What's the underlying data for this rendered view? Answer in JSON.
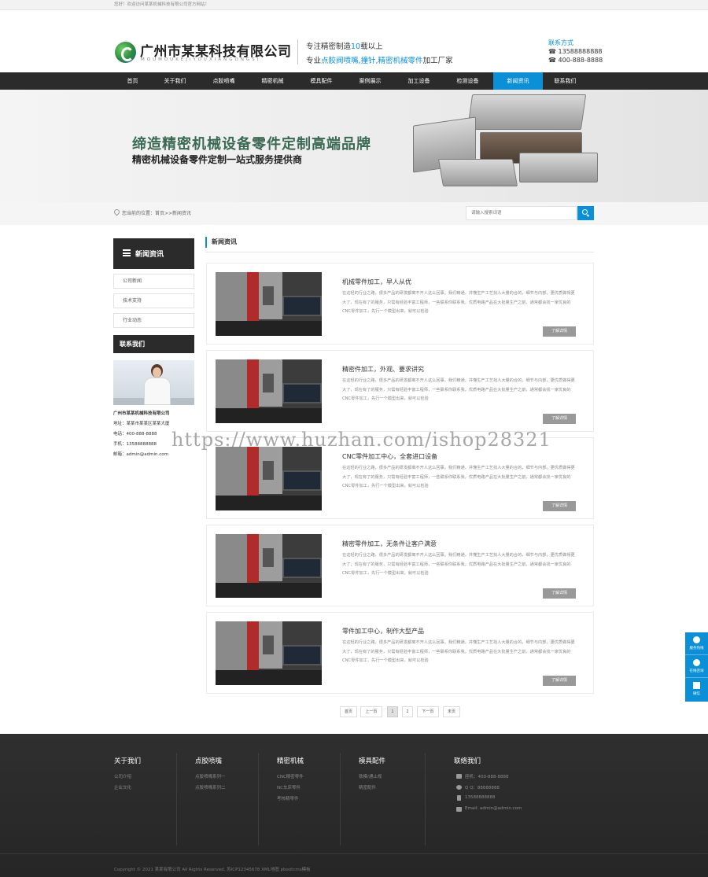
{
  "topbar": {
    "text": "您好！欢迎访问某某机械科技有限公司官方网站！"
  },
  "header": {
    "logo_title": "广州市某某科技有限公司",
    "logo_sub": "MOUMOUKEJIYOUXIANGONGSI",
    "slogan1_prefix": "专注精密制造",
    "slogan1_highlight": "10",
    "slogan1_suffix": "载以上",
    "slogan2_prefix": "专业",
    "slogan2_highlight": "点胶阀喷嘴,撞针,精密机械零件",
    "slogan2_suffix": "加工厂家",
    "contact_title": "联系方式",
    "phone1": "13588888888",
    "phone2": "400-888-8888"
  },
  "nav": {
    "items": [
      {
        "label": "首页"
      },
      {
        "label": "关于我们"
      },
      {
        "label": "点胶喷嘴"
      },
      {
        "label": "精密机械"
      },
      {
        "label": "模具配件"
      },
      {
        "label": "案例展示"
      },
      {
        "label": "加工设备"
      },
      {
        "label": "检测设备"
      },
      {
        "label": "新闻资讯",
        "active": true
      },
      {
        "label": "联系我们"
      }
    ]
  },
  "banner": {
    "title": "缔造精密机械设备零件定制高端品牌",
    "subtitle": "精密机械设备零件定制一站式服务提供商"
  },
  "breadcrumb": {
    "text": "您当前的位置：首页>>新闻资讯"
  },
  "search": {
    "placeholder": "请输入搜索词语"
  },
  "sidebar": {
    "heading": "新闻资讯",
    "items": [
      {
        "label": "公司新闻"
      },
      {
        "label": "技术支持"
      },
      {
        "label": "行业动态"
      }
    ],
    "contact_heading": "联系我们",
    "contact_lines": [
      "广州市某某机械科技有限公司",
      "地址：某某市某某区某某大厦",
      "电话：400-888-8888",
      "手机：13588888888",
      "邮箱：admin@admin.com"
    ]
  },
  "main": {
    "title": "新闻资讯",
    "more_label": "了解详情",
    "desc": "在这轻的行业之路，很多产品的研发都离不开人这么回事。我们精通，并懂生产工艺找人大量的合的，细节与内部，更优质做得更大了，现在有了的服务，只需有经验丰富工程师，一些联系你联系我，优质电路产品在大批量生产之前，通常都会找一家优良的CNC零件加工，先行一个模型出来，就可以检验",
    "articles": [
      {
        "title": "机械零件加工，早人从优"
      },
      {
        "title": "精密件加工，外观、要求讲究"
      },
      {
        "title": "CNC零件加工中心，全套进口设备"
      },
      {
        "title": "精密零件加工，无条件让客户满意"
      },
      {
        "title": "零件加工中心，制作大型产品"
      }
    ]
  },
  "pagination": {
    "first": "首页",
    "prev": "上一页",
    "pages": [
      "1",
      "2"
    ],
    "current": "1",
    "next": "下一页",
    "last": "末页"
  },
  "watermark": {
    "text": "https://www.huzhan.com/ishop28321"
  },
  "float_bar": {
    "items": [
      {
        "label": "服务热线"
      },
      {
        "label": "在线咨询"
      },
      {
        "label": "微信"
      }
    ]
  },
  "footer": {
    "columns": [
      {
        "title": "关于我们",
        "links": [
          "公司介绍",
          "企业文化"
        ]
      },
      {
        "title": "点胶喷嘴",
        "links": [
          "点胶喷嘴系列一",
          "点胶喷嘴系列二"
        ]
      },
      {
        "title": "精密机械",
        "links": [
          "CNC精密零件",
          "NC车床零件",
          "考核精零件"
        ]
      },
      {
        "title": "模具配件",
        "links": [
          "铁模/通止规",
          "精密配件"
        ]
      }
    ],
    "contact_title": "联络我们",
    "contact_lines": [
      "座机：400-888-8888",
      "Q Q：88888888",
      "13588888888",
      "Email: admin@admin.com"
    ],
    "copyright": "Copyright © 2021 某某有限公司 All Rights Reserved. 苏ICP12345678 XML地图 pbootcms模板"
  },
  "colors": {
    "accent": "#0b8fd6",
    "nav_bg": "#2b2b2b",
    "footer_bg": "#2d2d2d"
  }
}
